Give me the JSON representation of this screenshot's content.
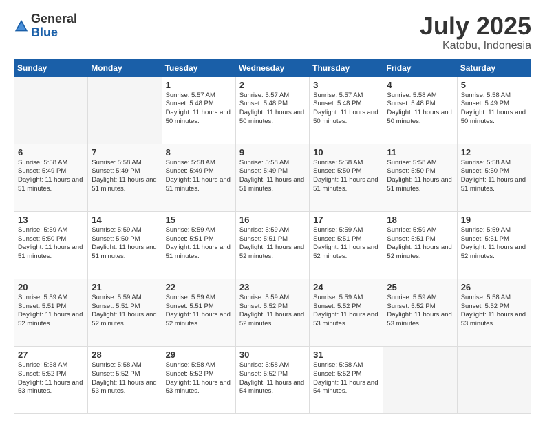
{
  "header": {
    "logo_general": "General",
    "logo_blue": "Blue",
    "month_year": "July 2025",
    "location": "Katobu, Indonesia"
  },
  "weekdays": [
    "Sunday",
    "Monday",
    "Tuesday",
    "Wednesday",
    "Thursday",
    "Friday",
    "Saturday"
  ],
  "weeks": [
    [
      {
        "day": "",
        "info": ""
      },
      {
        "day": "",
        "info": ""
      },
      {
        "day": "1",
        "info": "Sunrise: 5:57 AM\nSunset: 5:48 PM\nDaylight: 11 hours and 50 minutes."
      },
      {
        "day": "2",
        "info": "Sunrise: 5:57 AM\nSunset: 5:48 PM\nDaylight: 11 hours and 50 minutes."
      },
      {
        "day": "3",
        "info": "Sunrise: 5:57 AM\nSunset: 5:48 PM\nDaylight: 11 hours and 50 minutes."
      },
      {
        "day": "4",
        "info": "Sunrise: 5:58 AM\nSunset: 5:48 PM\nDaylight: 11 hours and 50 minutes."
      },
      {
        "day": "5",
        "info": "Sunrise: 5:58 AM\nSunset: 5:49 PM\nDaylight: 11 hours and 50 minutes."
      }
    ],
    [
      {
        "day": "6",
        "info": "Sunrise: 5:58 AM\nSunset: 5:49 PM\nDaylight: 11 hours and 51 minutes."
      },
      {
        "day": "7",
        "info": "Sunrise: 5:58 AM\nSunset: 5:49 PM\nDaylight: 11 hours and 51 minutes."
      },
      {
        "day": "8",
        "info": "Sunrise: 5:58 AM\nSunset: 5:49 PM\nDaylight: 11 hours and 51 minutes."
      },
      {
        "day": "9",
        "info": "Sunrise: 5:58 AM\nSunset: 5:49 PM\nDaylight: 11 hours and 51 minutes."
      },
      {
        "day": "10",
        "info": "Sunrise: 5:58 AM\nSunset: 5:50 PM\nDaylight: 11 hours and 51 minutes."
      },
      {
        "day": "11",
        "info": "Sunrise: 5:58 AM\nSunset: 5:50 PM\nDaylight: 11 hours and 51 minutes."
      },
      {
        "day": "12",
        "info": "Sunrise: 5:58 AM\nSunset: 5:50 PM\nDaylight: 11 hours and 51 minutes."
      }
    ],
    [
      {
        "day": "13",
        "info": "Sunrise: 5:59 AM\nSunset: 5:50 PM\nDaylight: 11 hours and 51 minutes."
      },
      {
        "day": "14",
        "info": "Sunrise: 5:59 AM\nSunset: 5:50 PM\nDaylight: 11 hours and 51 minutes."
      },
      {
        "day": "15",
        "info": "Sunrise: 5:59 AM\nSunset: 5:51 PM\nDaylight: 11 hours and 51 minutes."
      },
      {
        "day": "16",
        "info": "Sunrise: 5:59 AM\nSunset: 5:51 PM\nDaylight: 11 hours and 52 minutes."
      },
      {
        "day": "17",
        "info": "Sunrise: 5:59 AM\nSunset: 5:51 PM\nDaylight: 11 hours and 52 minutes."
      },
      {
        "day": "18",
        "info": "Sunrise: 5:59 AM\nSunset: 5:51 PM\nDaylight: 11 hours and 52 minutes."
      },
      {
        "day": "19",
        "info": "Sunrise: 5:59 AM\nSunset: 5:51 PM\nDaylight: 11 hours and 52 minutes."
      }
    ],
    [
      {
        "day": "20",
        "info": "Sunrise: 5:59 AM\nSunset: 5:51 PM\nDaylight: 11 hours and 52 minutes."
      },
      {
        "day": "21",
        "info": "Sunrise: 5:59 AM\nSunset: 5:51 PM\nDaylight: 11 hours and 52 minutes."
      },
      {
        "day": "22",
        "info": "Sunrise: 5:59 AM\nSunset: 5:51 PM\nDaylight: 11 hours and 52 minutes."
      },
      {
        "day": "23",
        "info": "Sunrise: 5:59 AM\nSunset: 5:52 PM\nDaylight: 11 hours and 52 minutes."
      },
      {
        "day": "24",
        "info": "Sunrise: 5:59 AM\nSunset: 5:52 PM\nDaylight: 11 hours and 53 minutes."
      },
      {
        "day": "25",
        "info": "Sunrise: 5:59 AM\nSunset: 5:52 PM\nDaylight: 11 hours and 53 minutes."
      },
      {
        "day": "26",
        "info": "Sunrise: 5:58 AM\nSunset: 5:52 PM\nDaylight: 11 hours and 53 minutes."
      }
    ],
    [
      {
        "day": "27",
        "info": "Sunrise: 5:58 AM\nSunset: 5:52 PM\nDaylight: 11 hours and 53 minutes."
      },
      {
        "day": "28",
        "info": "Sunrise: 5:58 AM\nSunset: 5:52 PM\nDaylight: 11 hours and 53 minutes."
      },
      {
        "day": "29",
        "info": "Sunrise: 5:58 AM\nSunset: 5:52 PM\nDaylight: 11 hours and 53 minutes."
      },
      {
        "day": "30",
        "info": "Sunrise: 5:58 AM\nSunset: 5:52 PM\nDaylight: 11 hours and 54 minutes."
      },
      {
        "day": "31",
        "info": "Sunrise: 5:58 AM\nSunset: 5:52 PM\nDaylight: 11 hours and 54 minutes."
      },
      {
        "day": "",
        "info": ""
      },
      {
        "day": "",
        "info": ""
      }
    ]
  ]
}
